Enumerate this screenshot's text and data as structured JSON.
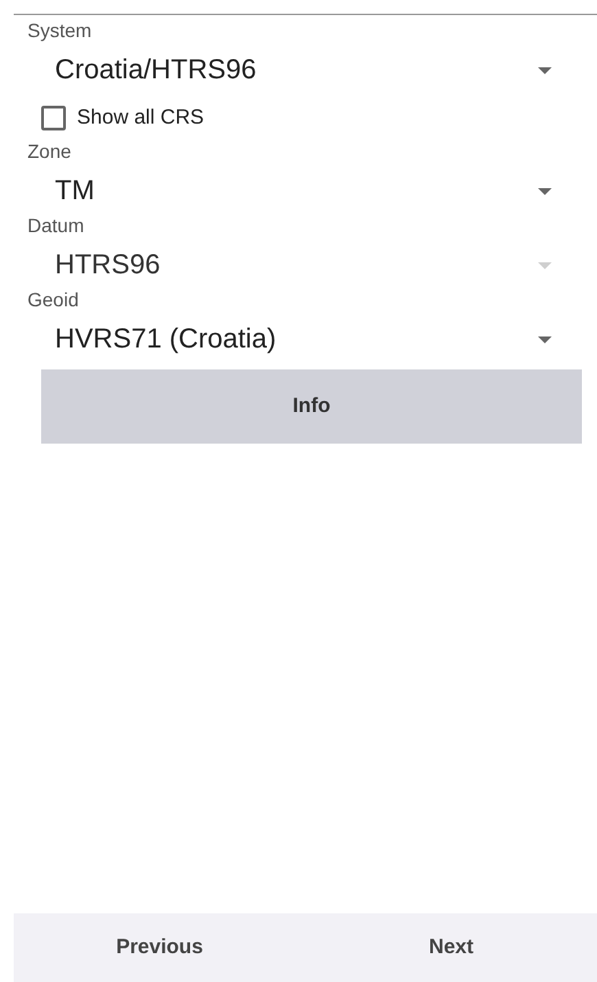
{
  "fields_top": [
    {
      "label": "System",
      "value": "Croatia/HTRS96",
      "disabled": false
    }
  ],
  "show_all_crs": {
    "label": "Show all CRS",
    "checked": false
  },
  "fields": [
    {
      "label": "Zone",
      "value": "TM",
      "disabled": false
    },
    {
      "label": "Datum",
      "value": "HTRS96",
      "disabled": true
    },
    {
      "label": "Geoid",
      "value": "HVRS71 (Croatia)",
      "disabled": false
    }
  ],
  "info_button": "Info",
  "nav": {
    "previous": "Previous",
    "next": "Next"
  }
}
